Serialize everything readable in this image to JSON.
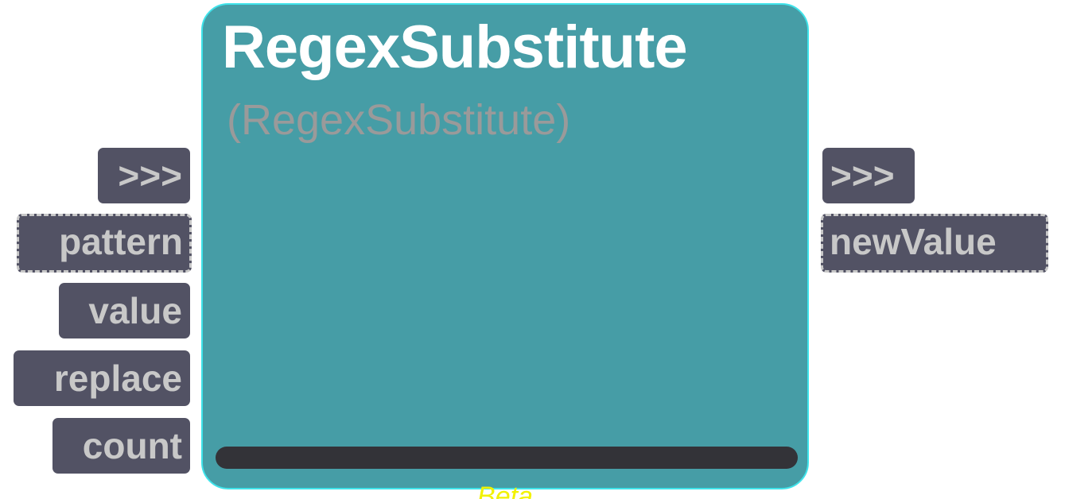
{
  "node": {
    "title": "RegexSubstitute",
    "subtitle": "(RegexSubstitute)",
    "footer": "Beta"
  },
  "inputs": [
    {
      "label": ">>>",
      "dashed": false
    },
    {
      "label": "pattern",
      "dashed": true
    },
    {
      "label": "value",
      "dashed": false
    },
    {
      "label": "replace",
      "dashed": false
    },
    {
      "label": "count",
      "dashed": false
    }
  ],
  "outputs": [
    {
      "label": ">>>",
      "dashed": false
    },
    {
      "label": "newValue",
      "dashed": true
    }
  ],
  "colors": {
    "node_fill": "#469da6",
    "node_border": "#3fe3ea",
    "port_fill": "#525264",
    "port_text": "#c8c8c8",
    "footer_text": "#f2f200"
  }
}
